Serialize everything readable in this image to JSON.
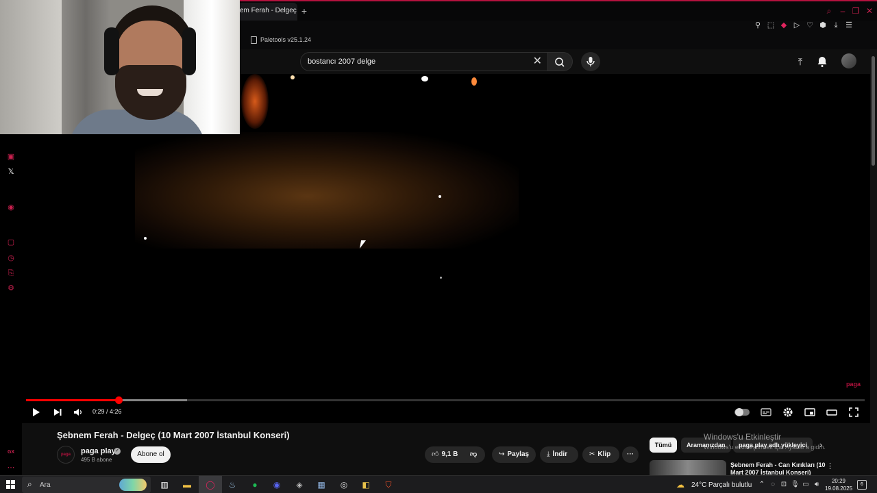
{
  "browser": {
    "tab_title": "em Ferah - Delgeç (",
    "new_tab_symbol": "+",
    "bookmark_label": "Paletools v25.1.24",
    "window_controls": [
      "search-icon",
      "minimize-icon",
      "restore-icon",
      "close-icon"
    ],
    "toolbar_icons": [
      "pin-icon",
      "screenshot-icon",
      "pocket-icon",
      "play-icon",
      "heart-icon",
      "extension-icon",
      "download-icon",
      "menu-icon"
    ],
    "accent_color": "#c8204e"
  },
  "masthead": {
    "search_value": "bostancı 2007 delge",
    "clear_symbol": "✕",
    "icons": [
      "search-icon",
      "mic-icon",
      "upload-icon",
      "bell-icon",
      "avatar"
    ]
  },
  "side_dock": {
    "icons": [
      "twitch-icon",
      "x-icon",
      "record-icon",
      "square-icon",
      "history-icon",
      "link-icon",
      "settings-icon",
      "gx-icon"
    ],
    "twitter_symbol": "𝕏",
    "gx_label": "GX"
  },
  "video": {
    "watermark": "paga",
    "current_time": "0:29",
    "duration": "4:26",
    "time_display": "0:29 / 4:26",
    "progress_played_fraction": 0.11,
    "progress_buffered_fraction": 0.192,
    "controls": [
      "play-icon",
      "next-icon",
      "volume-icon",
      "autoplay-toggle",
      "subtitles-icon",
      "settings-icon",
      "miniplayer-icon",
      "theater-icon",
      "fullscreen-icon"
    ]
  },
  "details": {
    "title": "Şebnem Ferah - Delgeç (10 Mart 2007 İstanbul Konseri)",
    "channel_name": "paga play",
    "channel_avatar_text": "paga",
    "subscribers": "495 B abone",
    "subscribe_label": "Abone ol",
    "likes": "9,1 B",
    "share_label": "Paylaş",
    "download_label": "İndir",
    "clip_label": "Klip",
    "more_symbol": "···"
  },
  "chips": {
    "all": "Tümü",
    "from_search": "Aramanızdan",
    "from_uploader": "paga play adlı yükleyici",
    "next_arrow": "›"
  },
  "related": {
    "title": "Şebnem Ferah - Can Kırıkları (10 Mart 2007 İstanbul Konseri)",
    "more_symbol": "⋮"
  },
  "activation": {
    "title": "Windows'u Etkinleştir",
    "subtitle": "Windows'u etkinleştirmek için Ayarlar'a gidin."
  },
  "taskbar": {
    "search_placeholder": "Ara",
    "temperature": "24°C",
    "condition": "Parçalı bulutlu",
    "time": "20:29",
    "date": "19.08.2025",
    "notification_count": "6",
    "apps": [
      "task-view-icon",
      "file-explorer-icon",
      "opera-gx-icon",
      "steam-icon",
      "spotify-icon",
      "discord-icon",
      "app-icon",
      "calculator-icon",
      "app-icon",
      "app-icon",
      "brave-icon"
    ]
  }
}
